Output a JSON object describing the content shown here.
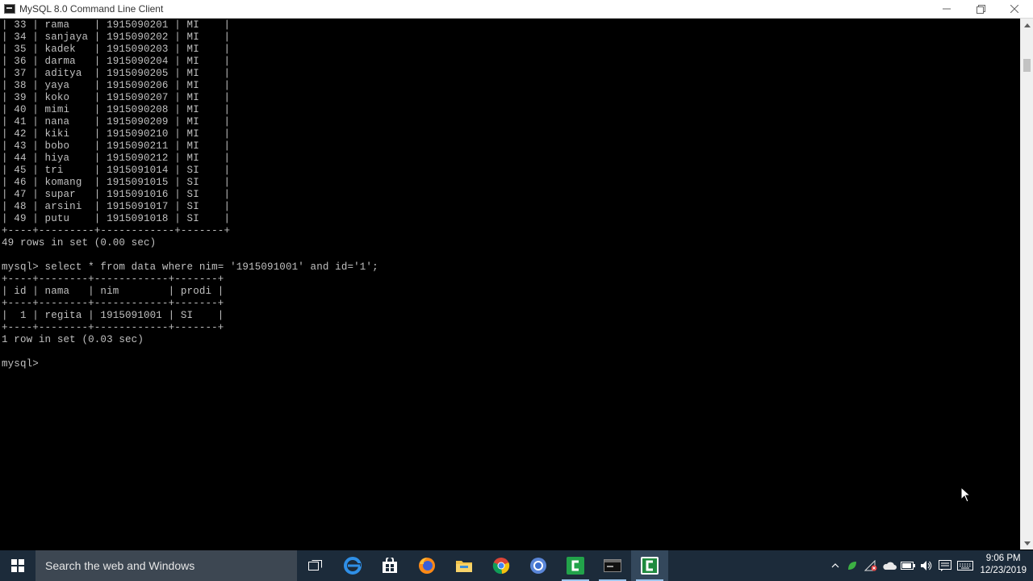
{
  "window": {
    "title": "MySQL 8.0 Command Line Client"
  },
  "console": {
    "lines": [
      "| 33 | rama    | 1915090201 | MI    |",
      "| 34 | sanjaya | 1915090202 | MI    |",
      "| 35 | kadek   | 1915090203 | MI    |",
      "| 36 | darma   | 1915090204 | MI    |",
      "| 37 | aditya  | 1915090205 | MI    |",
      "| 38 | yaya    | 1915090206 | MI    |",
      "| 39 | koko    | 1915090207 | MI    |",
      "| 40 | mimi    | 1915090208 | MI    |",
      "| 41 | nana    | 1915090209 | MI    |",
      "| 42 | kiki    | 1915090210 | MI    |",
      "| 43 | bobo    | 1915090211 | MI    |",
      "| 44 | hiya    | 1915090212 | MI    |",
      "| 45 | tri     | 1915091014 | SI    |",
      "| 46 | komang  | 1915091015 | SI    |",
      "| 47 | supar   | 1915091016 | SI    |",
      "| 48 | arsini  | 1915091017 | SI    |",
      "| 49 | putu    | 1915091018 | SI    |",
      "+----+---------+------------+-------+",
      "49 rows in set (0.00 sec)",
      "",
      "mysql> select * from data where nim= '1915091001' and id='1';",
      "+----+--------+------------+-------+",
      "| id | nama   | nim        | prodi |",
      "+----+--------+------------+-------+",
      "|  1 | regita | 1915091001 | SI    |",
      "+----+--------+------------+-------+",
      "1 row in set (0.03 sec)",
      "",
      "mysql> "
    ]
  },
  "taskbar": {
    "search_placeholder": "Search the web and Windows",
    "apps": [
      "task-view",
      "edge",
      "store",
      "firefox",
      "file-explorer",
      "chrome",
      "chromium",
      "camtasia",
      "mysql-client",
      "camtasia-recorder"
    ],
    "clock_time": "9:06 PM",
    "clock_date": "12/23/2019"
  },
  "colors": {
    "console_bg": "#000000",
    "console_text": "#c0c0c0",
    "taskbar_bg": "#1c2b3a",
    "search_bg": "#3d4752"
  }
}
